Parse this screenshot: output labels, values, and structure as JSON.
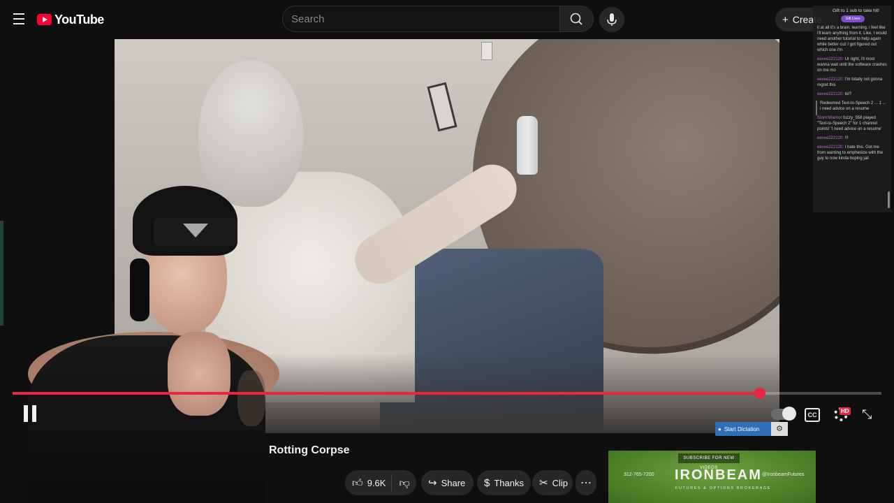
{
  "topbar": {
    "logo_text": "YouTube",
    "search_placeholder": "Search",
    "create_label": "Create"
  },
  "player": {
    "progress_fraction": 0.86,
    "dictation_label": "Start Dictation",
    "hd_label": "HD",
    "cc_label": "CC"
  },
  "chat": {
    "header": "Gift to 1 sub to take hit!",
    "badge": "Gift Lives",
    "lines": [
      {
        "user": "",
        "text": "it at all it's a brain. learning. i feel like i'll learn anything from it. Like, I would need another tutorial to help again while better cuz I got figured out which one i'm"
      },
      {
        "user": "eevee222120:",
        "text": "Ur right, i'll most wanna wait until the software crashes on me mo"
      },
      {
        "user": "eevee222120:",
        "text": "I'm totally not gonna regret this"
      },
      {
        "user": "eevee222120:",
        "text": "lol?"
      },
      {
        "user": "",
        "text": "Redeemed Text-to-Speech 2 ... 1 ... i need advice on a resume",
        "redeem": true
      },
      {
        "user": "StormWarrior",
        "text": "fuzzy_558 played \"Text-to-Speech 2\" for 1 channel points! 'I need advice on a resume'"
      },
      {
        "user": "eevee222120:",
        "text": "!!!"
      },
      {
        "user": "eevee222120:",
        "text": "I hate this. Got me from wanting to emphesize with the guy to now kinda hoping jail"
      }
    ]
  },
  "video": {
    "title_visible": "Rotting Corpse"
  },
  "actions": {
    "likes": "9.6K",
    "share": "Share",
    "thanks": "Thanks",
    "clip": "Clip",
    "more": "⋯"
  },
  "ad": {
    "cta": "SUBSCRIBE FOR NEW VIDEOS",
    "brand": "IRONBEAM",
    "tagline": "FUTURES & OPTIONS BROKERAGE",
    "phone": "312-765-7200",
    "handle": "@IronbeamFutures"
  },
  "colors": {
    "accent": "#e8263d",
    "background": "#0f0f0f",
    "pill": "#272727"
  }
}
